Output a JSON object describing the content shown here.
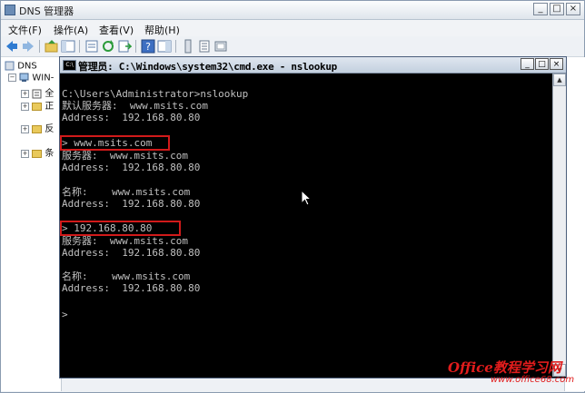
{
  "dns_window": {
    "title": "DNS 管理器",
    "controls": {
      "minimize": "_",
      "maximize": "□",
      "close": "×"
    }
  },
  "menubar": [
    {
      "label": "文件(F)"
    },
    {
      "label": "操作(A)"
    },
    {
      "label": "查看(V)"
    },
    {
      "label": "帮助(H)"
    }
  ],
  "tree": {
    "root_label": "DNS",
    "server_label": "WIN-",
    "children": [
      "全",
      "正",
      "反",
      "条"
    ]
  },
  "cmd_window": {
    "icon_text": "C:\\",
    "title": "管理员: C:\\Windows\\system32\\cmd.exe - nslookup",
    "controls": {
      "minimize": "_",
      "maximize": "□",
      "close": "×"
    }
  },
  "console_lines": [
    "C:\\Users\\Administrator>nslookup",
    "默认服务器:  www.msits.com",
    "Address:  192.168.80.80",
    "",
    "> www.msits.com",
    "服务器:  www.msits.com",
    "Address:  192.168.80.80",
    "",
    "名称:    www.msits.com",
    "Address:  192.168.80.80",
    "",
    "> 192.168.80.80",
    "服务器:  www.msits.com",
    "Address:  192.168.80.80",
    "",
    "名称:    www.msits.com",
    "Address:  192.168.80.80",
    "",
    ">"
  ],
  "scrollbar": {
    "up": "▲",
    "down": "▼"
  },
  "watermark": {
    "brand": "Office教程学习网",
    "url": "www.office68.com"
  },
  "colors": {
    "highlight": "#d11a1a",
    "console_bg": "#000000",
    "console_text": "#c0c0c0"
  }
}
